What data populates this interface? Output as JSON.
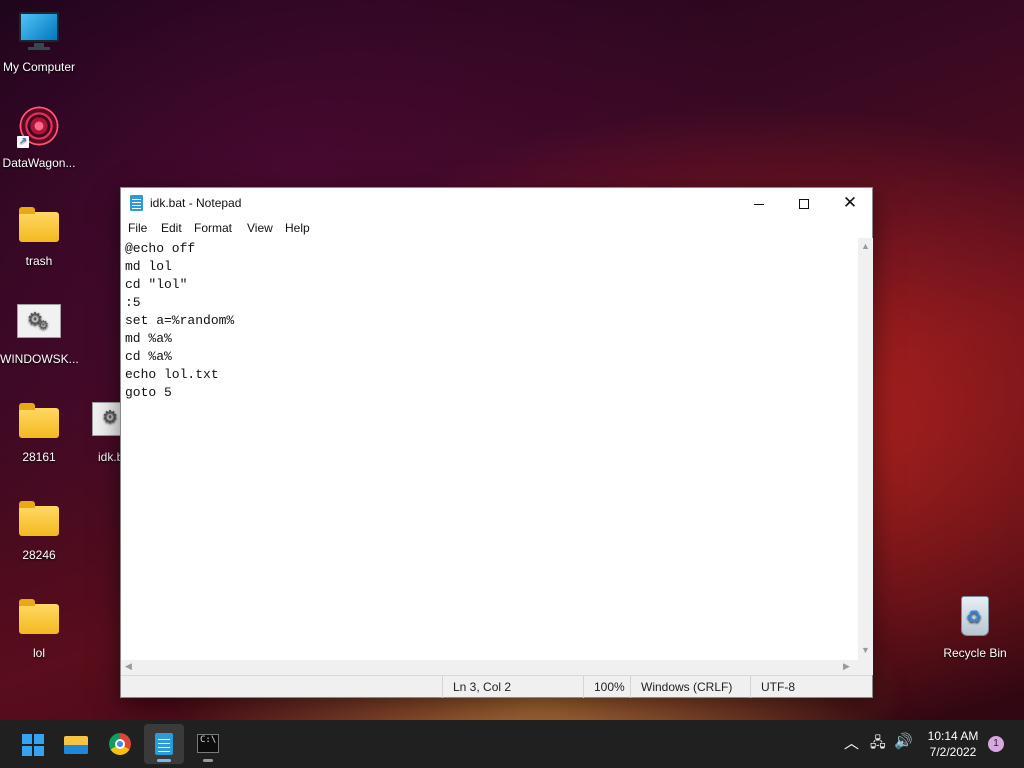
{
  "desktop": {
    "icons": [
      {
        "label": "My Computer",
        "icon": "monitor-icon"
      },
      {
        "label": "DataWagon...",
        "icon": "app-shortcut-icon"
      },
      {
        "label": "trash",
        "icon": "folder-icon"
      },
      {
        "label": "WINDOWSK...",
        "icon": "batch-file-icon"
      },
      {
        "label": "28161",
        "icon": "folder-icon"
      },
      {
        "label": "idk.b",
        "icon": "batch-file-icon"
      },
      {
        "label": "28246",
        "icon": "folder-icon"
      },
      {
        "label": "lol",
        "icon": "folder-icon"
      },
      {
        "label": "Recycle Bin",
        "icon": "recycle-bin-icon"
      }
    ]
  },
  "notepad": {
    "title": "idk.bat - Notepad",
    "menu": [
      "File",
      "Edit",
      "Format",
      "View",
      "Help"
    ],
    "lines": [
      "@echo off",
      "md lol",
      "cd \"lol\"",
      ":5",
      "set a=%random%",
      "md %a%",
      "cd %a%",
      "echo lol.txt",
      "goto 5"
    ],
    "status": {
      "position": "Ln 3, Col 2",
      "zoom": "100%",
      "line_ending": "Windows (CRLF)",
      "encoding": "UTF-8"
    }
  },
  "taskbar": {
    "apps": [
      "start-icon",
      "file-explorer-icon",
      "chrome-icon",
      "notepad-icon",
      "command-prompt-icon"
    ],
    "active_app": "notepad-icon",
    "clock": {
      "time": "10:14 AM",
      "date": "7/2/2022"
    },
    "notification_count": "1"
  },
  "colors": {
    "accent": "#76b9ed",
    "taskbar": "#202020",
    "notepad_icon": "#2e9bd6"
  }
}
